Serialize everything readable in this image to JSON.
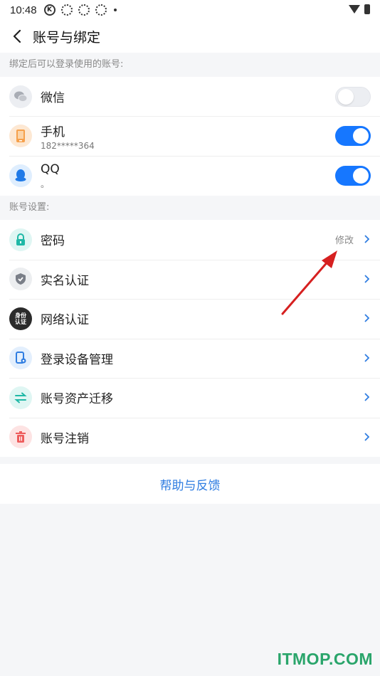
{
  "status_bar": {
    "time": "10:48",
    "icons": [
      "k-circle-icon",
      "app-icon",
      "app-icon",
      "app-icon",
      "dot-icon"
    ],
    "k_label": "K"
  },
  "header": {
    "title": "账号与绑定"
  },
  "binding_section": {
    "label": "绑定后可以登录使用的账号:",
    "items": [
      {
        "label": "微信",
        "sub": "",
        "toggle": "off",
        "icon": "wechat-icon",
        "icon_bg": "#eceef2"
      },
      {
        "label": "手机",
        "sub": "182*****364",
        "toggle": "on",
        "icon": "phone-icon",
        "icon_bg": "#fde8d3"
      },
      {
        "label": "QQ",
        "sub": "。",
        "toggle": "on",
        "icon": "qq-icon",
        "icon_bg": "#dfeefe"
      }
    ]
  },
  "settings_section": {
    "label": "账号设置:",
    "items": [
      {
        "label": "密码",
        "hint": "修改",
        "icon": "lock-icon",
        "icon_bg": "#dff6f3"
      },
      {
        "label": "实名认证",
        "hint": "",
        "icon": "shield-icon",
        "icon_bg": "#eceef0"
      },
      {
        "label": "网络认证",
        "hint": "",
        "icon": "network-id-icon",
        "icon_bg": "#2b2b2b",
        "icon_text": "身份 认证"
      },
      {
        "label": "登录设备管理",
        "hint": "",
        "icon": "device-icon",
        "icon_bg": "#e3effd"
      },
      {
        "label": "账号资产迁移",
        "hint": "",
        "icon": "transfer-icon",
        "icon_bg": "#dff6f3"
      },
      {
        "label": "账号注销",
        "hint": "",
        "icon": "trash-icon",
        "icon_bg": "#fde3e3"
      }
    ]
  },
  "help": {
    "label": "帮助与反馈"
  },
  "watermark": "ITMOP.COM",
  "colors": {
    "accent": "#1677ff",
    "link": "#2f7de1",
    "annotation_arrow": "#d62020"
  }
}
